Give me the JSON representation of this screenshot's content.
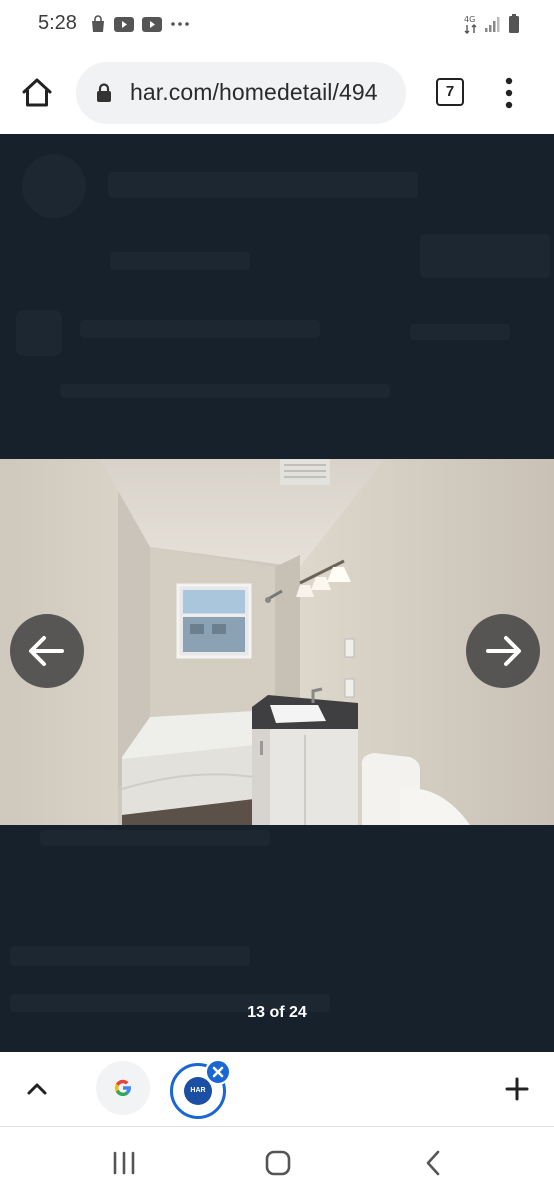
{
  "status_bar": {
    "time": "5:28",
    "left_icons": [
      "shopping-bag-icon",
      "youtube-icon",
      "youtube-icon",
      "more-notifications-icon"
    ],
    "right_icons": [
      "data-transfer-icon",
      "signal-icon",
      "battery-icon"
    ]
  },
  "browser": {
    "url": "har.com/homedetail/494",
    "tab_count": "7",
    "icons": [
      "home-icon",
      "lock-icon",
      "more-vert-icon"
    ]
  },
  "viewer": {
    "counter": "13 of 24",
    "current_photo": 13,
    "total_photos": 24,
    "photo_alt": "bathroom photo",
    "background": "#17212b"
  },
  "tab_strip": {
    "har_logo_text": "HAR",
    "icons": [
      "chevron-up-icon",
      "google-icon",
      "close-icon",
      "plus-icon"
    ]
  },
  "colors": {
    "accent": "#1a66d2",
    "viewer_bg": "#17212b"
  }
}
